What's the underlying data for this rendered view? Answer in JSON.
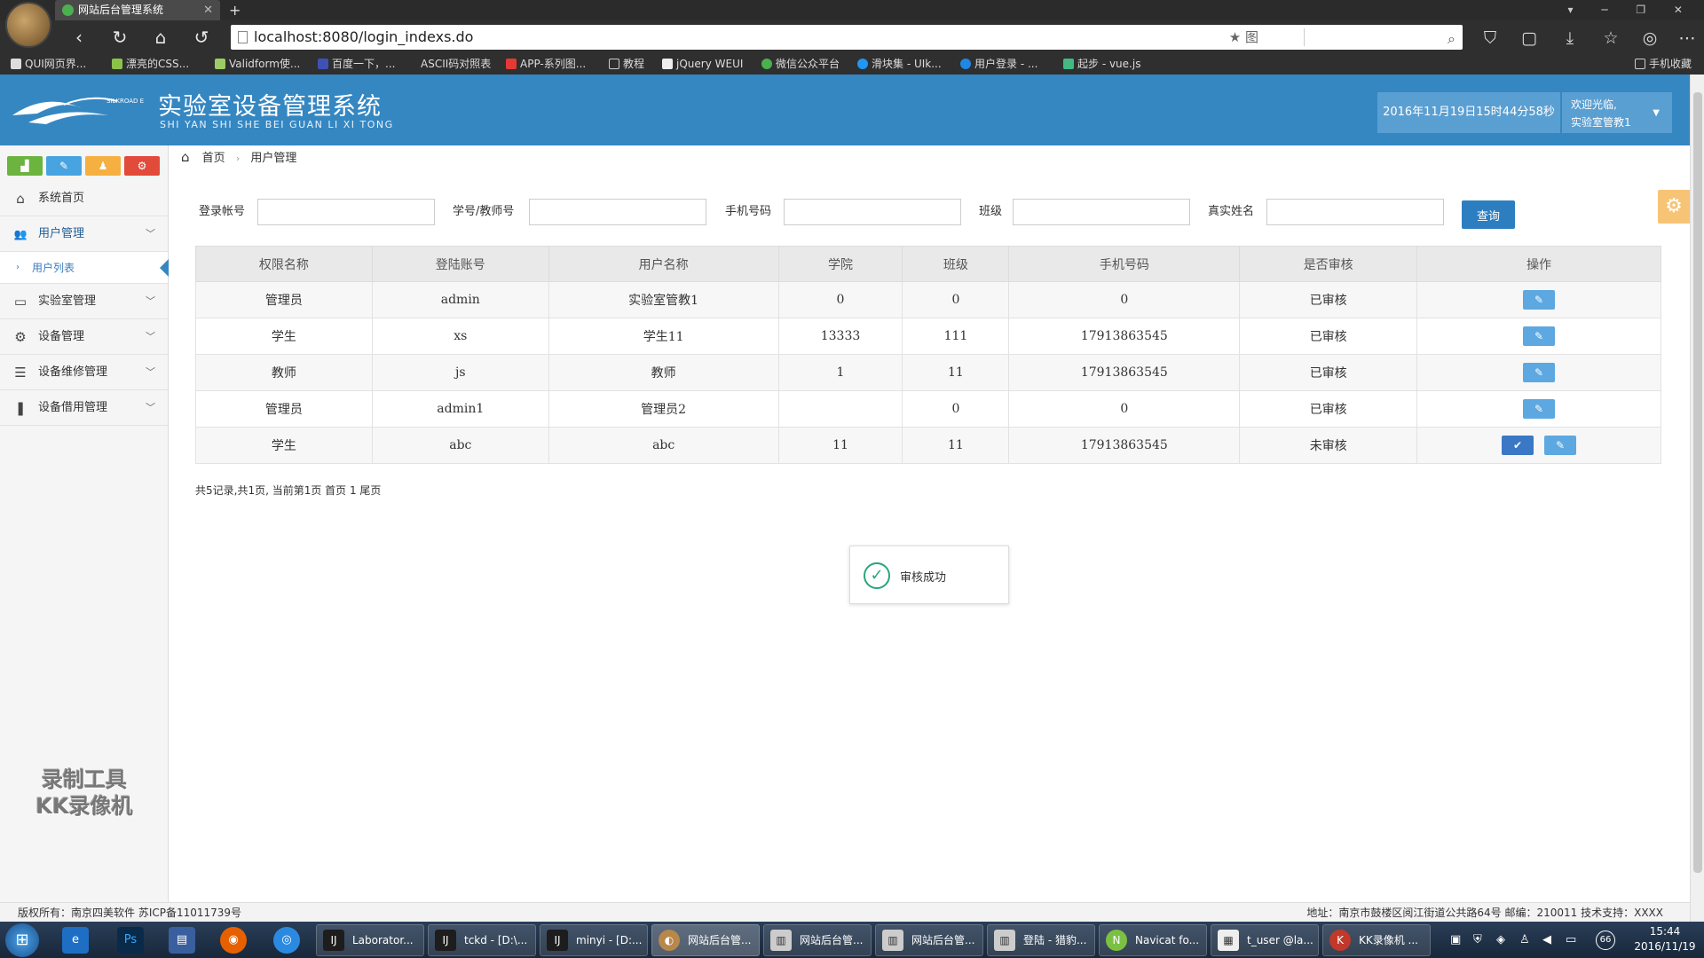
{
  "browser": {
    "tab_title": "网站后台管理系统",
    "url": "localhost:8080/login_indexs.do",
    "bookmarks": [
      "QUI网页界...",
      "漂亮的CSS...",
      "Validform使...",
      "百度一下，...",
      "ASCII码对照表",
      "APP-系列图...",
      "教程",
      "jQuery WEUI",
      "微信公众平台",
      "滑块集 - UIk...",
      "用户登录 - ...",
      "起步 - vue.js",
      "手机收藏"
    ],
    "star_label": "★ 图",
    "win_controls": "▾ ─ ❐ ✕"
  },
  "header": {
    "logo_brand": "SILKROAD EDU",
    "title": "实验室设备管理系统",
    "subtitle": "SHI YAN SHI SHE BEI GUAN LI XI TONG",
    "datetime": "2016年11月19日15时44分58秒",
    "welcome": "欢迎光临,",
    "username": "实验室管教1"
  },
  "sidebar": {
    "menus": [
      {
        "label": "系统首页",
        "icon": "home-icon",
        "glyph": "⌂"
      },
      {
        "label": "用户管理",
        "icon": "users-icon",
        "glyph": "👥"
      },
      {
        "label": "实验室管理",
        "icon": "monitor-icon",
        "glyph": "▭"
      },
      {
        "label": "设备管理",
        "icon": "gears-icon",
        "glyph": "⚙"
      },
      {
        "label": "设备维修管理",
        "icon": "list-icon",
        "glyph": "☰"
      },
      {
        "label": "设备借用管理",
        "icon": "bookmark-icon",
        "glyph": "❚"
      }
    ],
    "submenu_active": "用户列表",
    "watermark_line1": "录制工具",
    "watermark_line2": "KK录像机"
  },
  "breadcrumb": {
    "home": "首页",
    "current": "用户管理"
  },
  "filters": {
    "login_label": "登录帐号",
    "id_label": "学号/教师号",
    "phone_label": "手机号码",
    "class_label": "班级",
    "name_label": "真实姓名",
    "query_button": "查询"
  },
  "table": {
    "headers": [
      "权限名称",
      "登陆账号",
      "用户名称",
      "学院",
      "班级",
      "手机号码",
      "是否审核",
      "操作"
    ],
    "rows": [
      {
        "role": "管理员",
        "account": "admin",
        "name": "实验室管教1",
        "college": "0",
        "class": "0",
        "phone": "0",
        "status": "已审核"
      },
      {
        "role": "学生",
        "account": "xs",
        "name": "学生11",
        "college": "13333",
        "class": "111",
        "phone": "17913863545",
        "status": "已审核"
      },
      {
        "role": "教师",
        "account": "js",
        "name": "教师",
        "college": "1",
        "class": "11",
        "phone": "17913863545",
        "status": "已审核"
      },
      {
        "role": "管理员",
        "account": "admin1",
        "name": "管理员2",
        "college": "",
        "class": "0",
        "phone": "0",
        "status": "已审核"
      },
      {
        "role": "学生",
        "account": "abc",
        "name": "abc",
        "college": "11",
        "class": "11",
        "phone": "17913863545",
        "status": "未审核"
      }
    ]
  },
  "pagination": "共5记录,共1页, 当前第1页 首页 1 尾页",
  "toast": "审核成功",
  "footer": {
    "left": "版权所有：南京四美软件 苏ICP备11011739号",
    "right": "地址：南京市鼓楼区阅江街道公共路64号 邮编：210011 技术支持：XXXX"
  },
  "taskbar": {
    "tasks": [
      "Laborator...",
      "tckd - [D:\\...",
      "minyi - [D:...",
      "网站后台管...",
      "网站后台管...",
      "网站后台管...",
      "登陆 - 猎豹...",
      "Navicat fo...",
      "t_user @la...",
      "KK录像机 ..."
    ],
    "time": "15:44",
    "date": "2016/11/19",
    "tray_count": "66"
  },
  "colors": {
    "header_blue": "#3587c2",
    "approved": "#1a3c8a",
    "pending": "#dd2222"
  }
}
